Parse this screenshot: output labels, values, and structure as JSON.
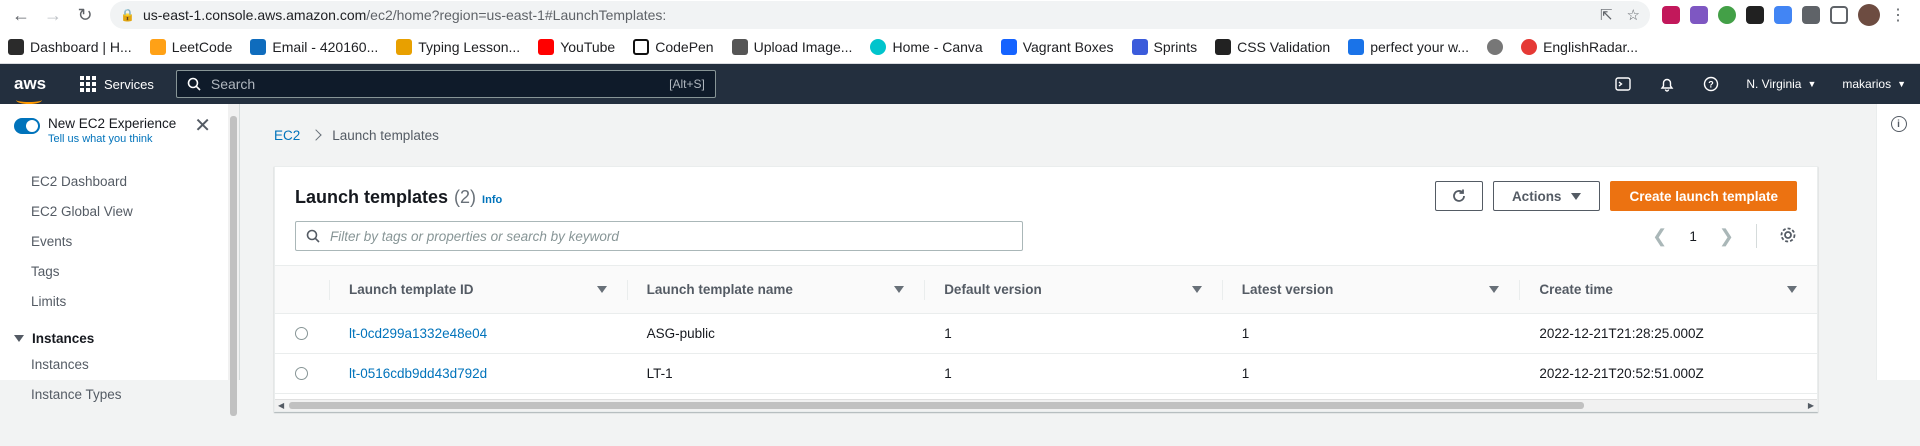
{
  "browser": {
    "url_host": "us-east-1.console.aws.amazon.com",
    "url_path": "/ec2/home?region=us-east-1#LaunchTemplates:",
    "bookmarks": [
      {
        "label": "Dashboard | H...",
        "color": "#2b2b2b"
      },
      {
        "label": "LeetCode",
        "color": "#ffa116"
      },
      {
        "label": "Email - 420160...",
        "color": "#0f6cbd"
      },
      {
        "label": "Typing Lesson...",
        "color": "#e8a000"
      },
      {
        "label": "YouTube",
        "color": "#ff0000"
      },
      {
        "label": "CodePen",
        "color": "#111111"
      },
      {
        "label": "Upload Image...",
        "color": "#555555"
      },
      {
        "label": "Home - Canva",
        "color": "#00c4cc"
      },
      {
        "label": "Vagrant Boxes",
        "color": "#1563ff"
      },
      {
        "label": "Sprints",
        "color": "#3b5bdb"
      },
      {
        "label": "CSS Validation",
        "color": "#222222"
      },
      {
        "label": "perfect your w...",
        "color": "#1a73e8"
      },
      {
        "label": "",
        "color": "#777777"
      },
      {
        "label": "EnglishRadar...",
        "color": "#e53935"
      }
    ]
  },
  "aws_nav": {
    "logo": "aws",
    "services_label": "Services",
    "search_placeholder": "Search",
    "search_shortcut": "[Alt+S]",
    "region": "N. Virginia",
    "user": "makarios"
  },
  "sidebar": {
    "new_experience_title": "New EC2 Experience",
    "new_experience_link": "Tell us what you think",
    "items": [
      "EC2 Dashboard",
      "EC2 Global View",
      "Events",
      "Tags",
      "Limits"
    ],
    "section": "Instances",
    "section_items": [
      "Instances",
      "Instance Types"
    ]
  },
  "breadcrumb": {
    "root": "EC2",
    "current": "Launch templates"
  },
  "panel": {
    "title": "Launch templates",
    "count": "(2)",
    "info": "Info",
    "actions_label": "Actions",
    "create_label": "Create launch template",
    "filter_placeholder": "Filter by tags or properties or search by keyword",
    "page": "1"
  },
  "table": {
    "columns": [
      "Launch template ID",
      "Launch template name",
      "Default version",
      "Latest version",
      "Create time"
    ],
    "rows": [
      {
        "id": "lt-0cd299a1332e48e04",
        "name": "ASG-public",
        "default_version": "1",
        "latest_version": "1",
        "create_time": "2022-12-21T21:28:25.000Z"
      },
      {
        "id": "lt-0516cdb9dd43d792d",
        "name": "LT-1",
        "default_version": "1",
        "latest_version": "1",
        "create_time": "2022-12-21T20:52:51.000Z"
      }
    ]
  }
}
